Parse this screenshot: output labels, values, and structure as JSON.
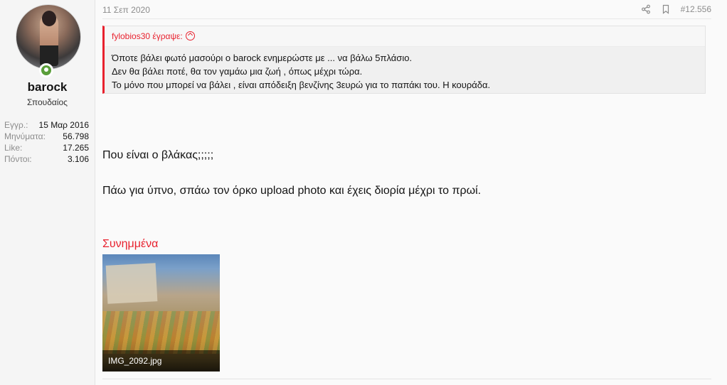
{
  "user": {
    "name": "barock",
    "title": "Σπουδαίος",
    "stats": [
      {
        "label": "Εγγρ.:",
        "value": "15 Μαρ 2016"
      },
      {
        "label": "Μηνύματα:",
        "value": "56.798"
      },
      {
        "label": "Like:",
        "value": "17.265"
      },
      {
        "label": "Πόντοι:",
        "value": "3.106"
      }
    ]
  },
  "post": {
    "date": "11 Σεπ 2020",
    "number": "#12.556",
    "quote": {
      "author": "fylobios30 έγραψε:",
      "lines": [
        "Όποτε βάλει φωτό μασούρι ο barock ενημερώστε με ... να βάλω 5πλάσιο.",
        "Δεν θα βάλει ποτέ, θα τον γαμάω μια ζωή , όπως μέχρι τώρα.",
        "Το μόνο που μπορεί να βάλει , είναι απόδειξη βενζίνης 3ευρώ για το παπάκι του. Η κουράδα."
      ]
    },
    "message_lines": [
      "Που είναι ο βλάκας;;;;;",
      "Πάω για ύπνο, σπάω τον όρκο upload photo και έχεις διορία μέχρι το πρωί."
    ],
    "attachments_title": "Συνημμένα",
    "attachment": {
      "filename": "IMG_2092.jpg"
    }
  },
  "colors": {
    "accent": "#e8212e",
    "online": "#5a9e3a"
  },
  "icons": {
    "share": "share-icon",
    "bookmark": "bookmark-icon",
    "quote_up": "arrow-up-circle-icon"
  }
}
